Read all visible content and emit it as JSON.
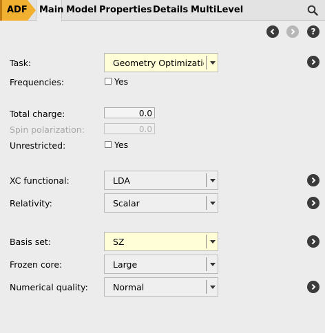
{
  "tabs": {
    "adf": "ADF",
    "main": "Main",
    "model": "Model",
    "properties": "Properties",
    "details": "Details",
    "multilevel": "MultiLevel"
  },
  "nav": {
    "help": "?"
  },
  "form": {
    "task": {
      "label": "Task:",
      "value": "Geometry Optimization"
    },
    "frequencies": {
      "label": "Frequencies:",
      "check_label": "Yes",
      "checked": false
    },
    "total_charge": {
      "label": "Total charge:",
      "value": "0.0"
    },
    "spin_polarization": {
      "label": "Spin polarization:",
      "value": "0.0"
    },
    "unrestricted": {
      "label": "Unrestricted:",
      "check_label": "Yes",
      "checked": false
    },
    "xc_functional": {
      "label": "XC functional:",
      "value": "LDA"
    },
    "relativity": {
      "label": "Relativity:",
      "value": "Scalar"
    },
    "basis_set": {
      "label": "Basis set:",
      "value": "SZ"
    },
    "frozen_core": {
      "label": "Frozen core:",
      "value": "Large"
    },
    "numerical_quality": {
      "label": "Numerical quality:",
      "value": "Normal"
    }
  },
  "colors": {
    "adf_tab": "#f2b030",
    "highlight_field": "#fffed6",
    "panel_bg": "#ececec",
    "button_dark": "#3b3b3b",
    "button_disabled": "#b7b7b7"
  }
}
